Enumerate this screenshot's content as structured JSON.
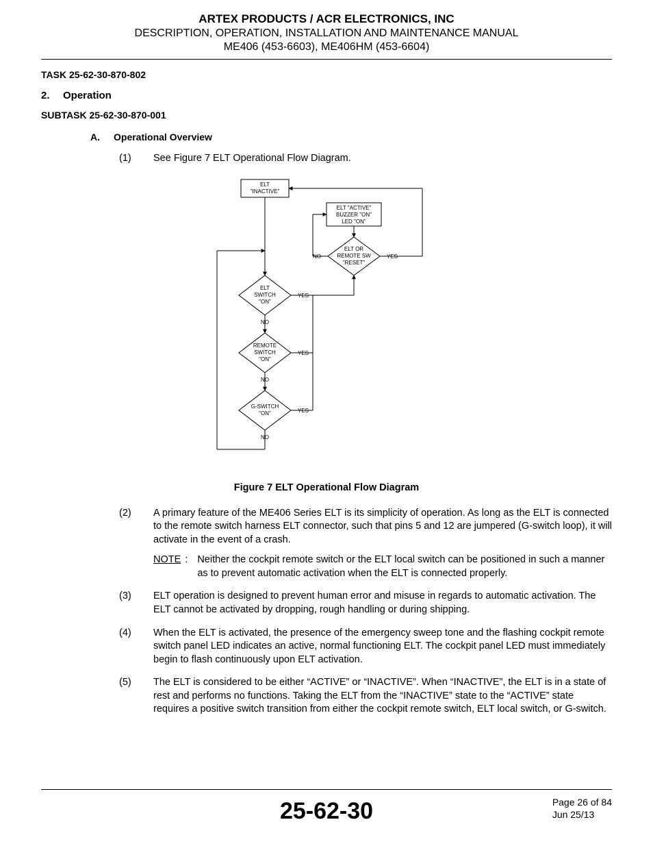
{
  "header": {
    "line1": "ARTEX PRODUCTS / ACR ELECTRONICS, INC",
    "line2": "DESCRIPTION, OPERATION, INSTALLATION AND MAINTENANCE MANUAL",
    "line3": "ME406 (453-6603), ME406HM (453-6604)"
  },
  "task_label": "TASK 25-62-30-870-802",
  "section": {
    "num": "2.",
    "title": "Operation"
  },
  "subtask_label": "SUBTASK 25-62-30-870-001",
  "sub_a": {
    "letter": "A.",
    "title": "Operational Overview"
  },
  "items": {
    "p1": {
      "num": "(1)",
      "text": "See Figure 7 ELT Operational Flow Diagram."
    },
    "p2": {
      "num": "(2)",
      "text": "A primary feature of the ME406 Series ELT is its simplicity of operation. As long as the ELT is connected to the remote switch harness ELT connector, such that pins 5 and 12 are jumpered (G-switch loop), it will activate in the event of a crash."
    },
    "p2_note": {
      "label": "NOTE",
      "colon": ":",
      "text": "Neither the cockpit remote switch or the ELT local switch can be positioned in such a manner as to prevent automatic activation when the ELT is connected properly."
    },
    "p3": {
      "num": "(3)",
      "text": "ELT operation is designed to prevent human error and misuse in regards to automatic activation. The ELT cannot be activated by dropping, rough handling or during shipping."
    },
    "p4": {
      "num": "(4)",
      "text": "When the ELT is activated, the presence of the emergency sweep tone and the flashing cockpit remote switch panel LED indicates an active, normal functioning ELT. The cockpit panel LED must immediately begin to flash continuously upon ELT activation."
    },
    "p5": {
      "num": "(5)",
      "text": "The ELT is considered to be either “ACTIVE” or “INACTIVE”. When “INACTIVE”, the ELT is in a state of rest and performs no functions. Taking the ELT from the “INACTIVE” state to the “ACTIVE” state requires a positive switch transition from either the cockpit remote switch, ELT local switch, or G-switch."
    }
  },
  "figure_caption": "Figure 7  ELT Operational Flow Diagram",
  "diagram": {
    "nodes": {
      "inactive": [
        "ELT",
        "\"INACTIVE\""
      ],
      "active": [
        "ELT \"ACTIVE\"",
        "BUZZER \"ON\"",
        "LED \"ON\""
      ],
      "reset": [
        "ELT OR",
        "REMOTE SW",
        "\"RESET\""
      ],
      "elt_sw": [
        "ELT",
        "SWITCH",
        "\"ON\""
      ],
      "rmt_sw": [
        "REMOTE",
        "SWITCH",
        "\"ON\""
      ],
      "g_sw": [
        "G-SWITCH",
        "\"ON\""
      ]
    },
    "labels": {
      "yes": "YES",
      "no": "NO"
    }
  },
  "footer": {
    "center": "25-62-30",
    "page": "Page 26 of 84",
    "date": "Jun 25/13"
  }
}
